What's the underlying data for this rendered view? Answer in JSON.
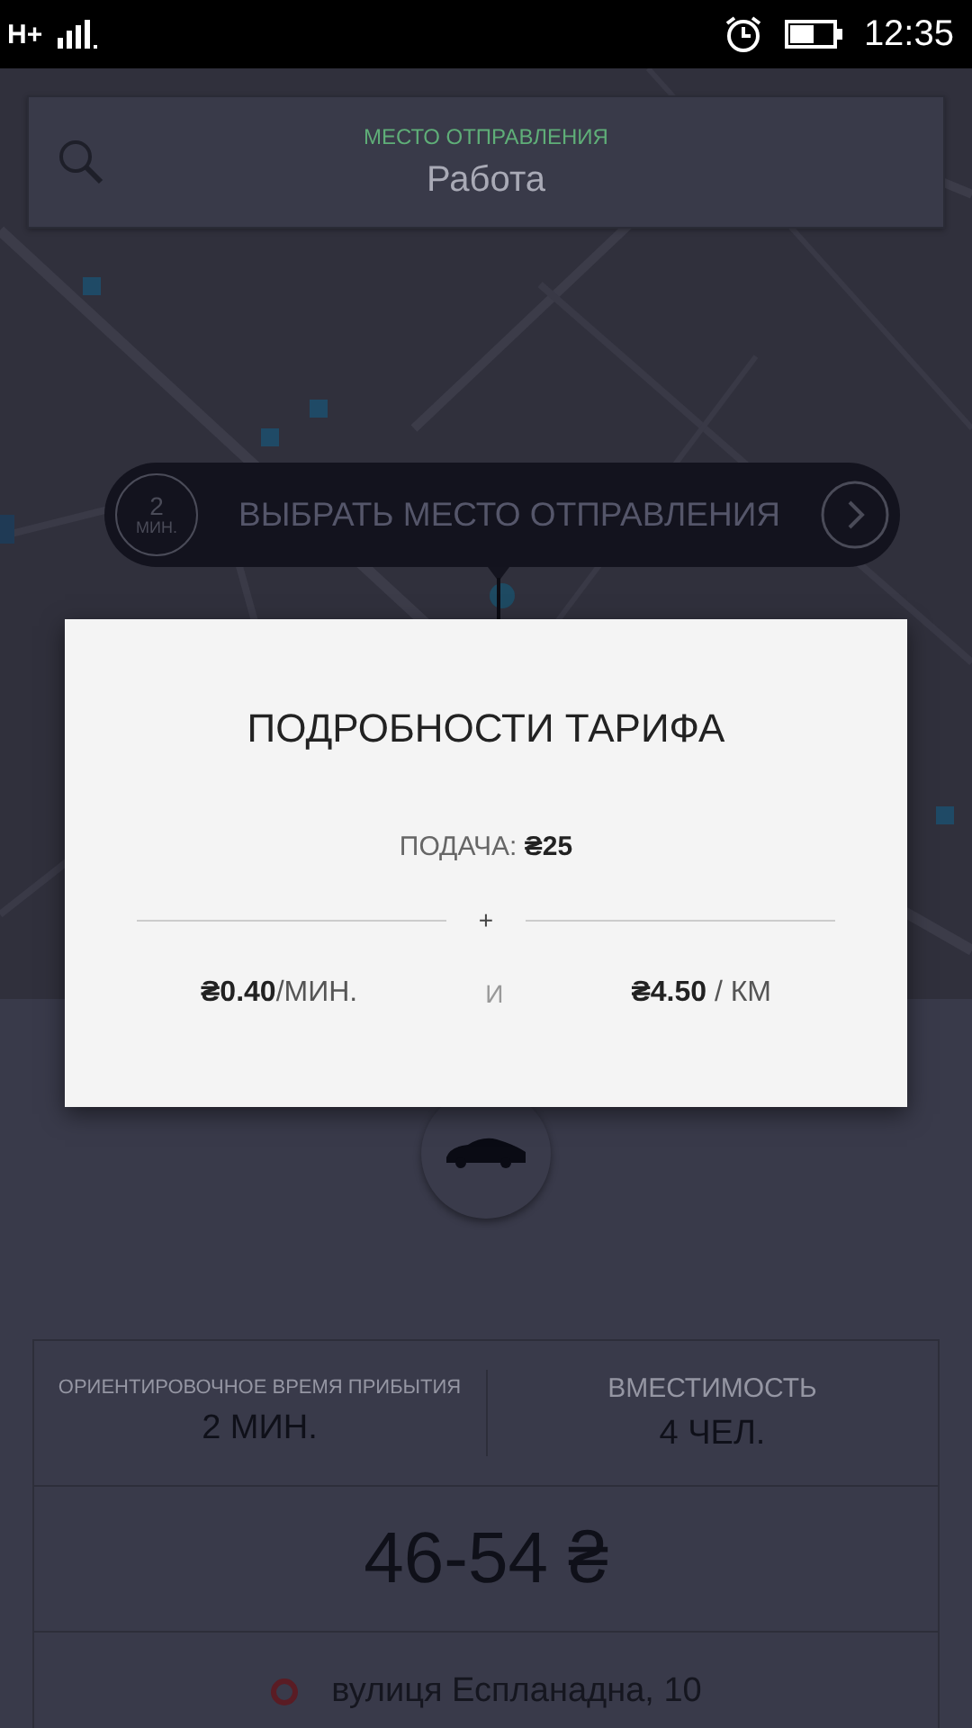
{
  "status_bar": {
    "network": "H+",
    "time": "12:35"
  },
  "pickup_field": {
    "label": "МЕСТО ОТПРАВЛЕНИЯ",
    "value": "Работа"
  },
  "pickup_button": {
    "eta_value": "2",
    "eta_unit": "МИН.",
    "label": "ВЫБРАТЬ МЕСТО ОТПРАВЛЕНИЯ"
  },
  "dialog": {
    "title": "ПОДРОБНОСТИ ТАРИФА",
    "base_fare": "ПОДАЧА: **₴25**",
    "separator": "+",
    "per_minute": "**₴0.40**/МИН.",
    "conjunction": "И",
    "per_km": "**₴4.50** / КМ"
  },
  "ride_info": {
    "stats": [
      {
        "label": "ОРИЕНТИРОВОЧНОЕ ВРЕМЯ ПРИБЫТИЯ",
        "value": "2 МИН."
      },
      {
        "label": "ВМЕСТИМОСТЬ",
        "value": "4 ЧЕЛ."
      }
    ],
    "price": "46-54 ₴",
    "address": "вулиця Еспланадна, 10"
  }
}
